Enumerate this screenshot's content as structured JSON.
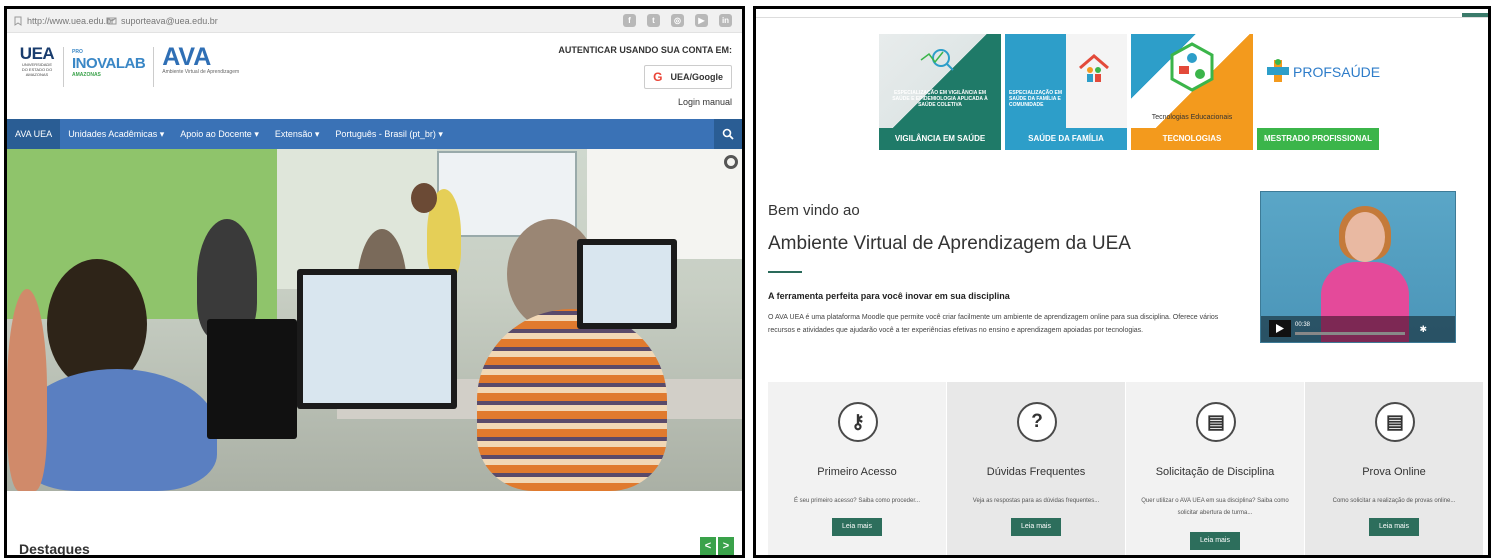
{
  "colors": {
    "nav_blue": "#3a72b6",
    "accent_green": "#3aa24a",
    "button_teal": "#2d6e5c"
  },
  "left": {
    "topbar": {
      "url": "http://www.uea.edu.br",
      "email": "suporteava@uea.edu.br"
    },
    "logos": {
      "uea": "UEA",
      "uea_sub": "UNIVERSIDADE DO ESTADO DO AMAZONAS",
      "inova": "INOVALAB",
      "inova_prefix": "PRO",
      "inova_sub": "AMAZONAS",
      "ava": "AVA",
      "ava_sub": "Ambiente Virtual de Aprendizagem"
    },
    "auth": {
      "label": "AUTENTICAR USANDO SUA CONTA EM:",
      "google_button": "UEA/Google",
      "manual_link": "Login manual"
    },
    "nav": {
      "items": [
        "AVA UEA",
        "Unidades Acadêmicas ▾",
        "Apoio ao Docente ▾",
        "Extensão ▾",
        "Português - Brasil (pt_br) ▾"
      ]
    },
    "highlights_title": "Destaques",
    "carousel_prev": "<",
    "carousel_next": ">"
  },
  "right": {
    "courses": [
      {
        "banner": "ESPECIALIZAÇÃO EM VIGILÂNCIA EM SAÚDE E EPIDEMIOLOGIA APLICADA À SAÚDE COLETIVA",
        "caption": "VIGILÂNCIA EM SAÚDE",
        "color": "#1f7a68"
      },
      {
        "banner": "ESPECIALIZAÇÃO EM SAÚDE DA FAMÍLIA E COMUNIDADE",
        "caption": "SAÚDE DA FAMÍLIA",
        "color": "#2d9ec9"
      },
      {
        "banner": "Tecnologias Educacionais",
        "caption": "TECNOLOGIAS EDUCACIONAIS",
        "color": "#f39a1d"
      },
      {
        "banner": "PROFSAÚDE",
        "caption": "MESTRADO PROFISSIONAL EM",
        "color": "#3bb54a"
      }
    ],
    "welcome": "Bem vindo ao",
    "welcome_title": "Ambiente Virtual de Aprendizagem da UEA",
    "tagline": "A ferramenta perfeita para você inovar em sua disciplina",
    "description": "O AVA UEA é uma plataforma Moodle que permite você criar facilmente um ambiente de aprendizagem online para sua disciplina. Oferece vários recursos e atividades que ajudarão você a ter experiências efetivas no ensino e aprendizagem apoiadas por tecnologias.",
    "video": {
      "time": "00:38"
    },
    "features": [
      {
        "icon": "key-icon",
        "glyph": "⚷",
        "title": "Primeiro Acesso",
        "text": "É seu primeiro acesso? Saiba como proceder...",
        "button": "Leia mais"
      },
      {
        "icon": "question-icon",
        "glyph": "?",
        "title": "Dúvidas Frequentes",
        "text": "Veja as respostas para as dúvidas frequentes...",
        "button": "Leia mais"
      },
      {
        "icon": "document-icon",
        "glyph": "▤",
        "title": "Solicitação de Disciplina",
        "text": "Quer utilizar o AVA UEA em sua disciplina? Saiba como solicitar abertura de turma...",
        "button": "Leia mais"
      },
      {
        "icon": "file-icon",
        "glyph": "▤",
        "title": "Prova Online",
        "text": "Como solicitar a realização de provas online...",
        "button": "Leia mais"
      }
    ]
  }
}
